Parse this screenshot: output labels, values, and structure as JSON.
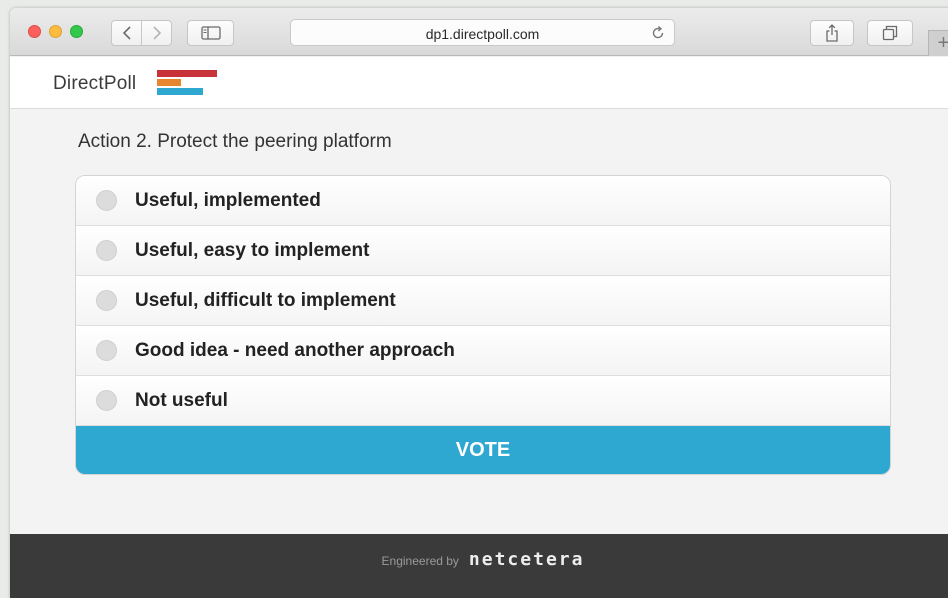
{
  "browser": {
    "url": "dp1.directpoll.com",
    "new_tab_label": "+"
  },
  "header": {
    "brand": "DirectPoll",
    "logo_colors": [
      "#c8323a",
      "#e6862e",
      "#2ea7d1"
    ]
  },
  "poll": {
    "question": "Action 2. Protect the peering platform",
    "options": [
      {
        "label": "Useful, implemented"
      },
      {
        "label": "Useful, easy to implement"
      },
      {
        "label": "Useful, difficult to implement"
      },
      {
        "label": "Good idea - need another approach"
      },
      {
        "label": "Not useful"
      }
    ],
    "vote_label": "VOTE"
  },
  "footer": {
    "engineered_by": "Engineered by",
    "company": "netcetera"
  },
  "colors": {
    "accent": "#2ea7d1",
    "footer_bg": "#3a3a3a"
  }
}
